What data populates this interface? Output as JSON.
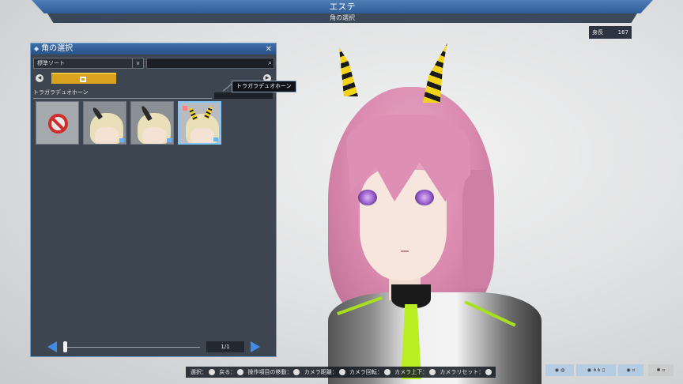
{
  "header": {
    "title": "エステ",
    "subtitle": "角の選択"
  },
  "height_display": {
    "label": "身長",
    "value": "167"
  },
  "panel": {
    "title": "角の選択",
    "sort_label": "標準ソート",
    "selected_name": "トラガラデュオホーン",
    "items_count": 4,
    "selected_index": 3,
    "page": "1/1"
  },
  "tooltip": "トラガラデュオホーン",
  "footer": {
    "select": "選択：",
    "back": "戻る：",
    "move": "操作項目の移動：",
    "cam_dist": "カメラ距離：",
    "cam_rot": "カメラ回転：",
    "cam_updown": "カメラ上下：",
    "cam_reset": "カメラリセット："
  },
  "colors": {
    "accent": "#3f8be8",
    "panel_bg": "#3c4550",
    "tab": "#d9a21c",
    "horn_yellow": "#f3d21a"
  }
}
